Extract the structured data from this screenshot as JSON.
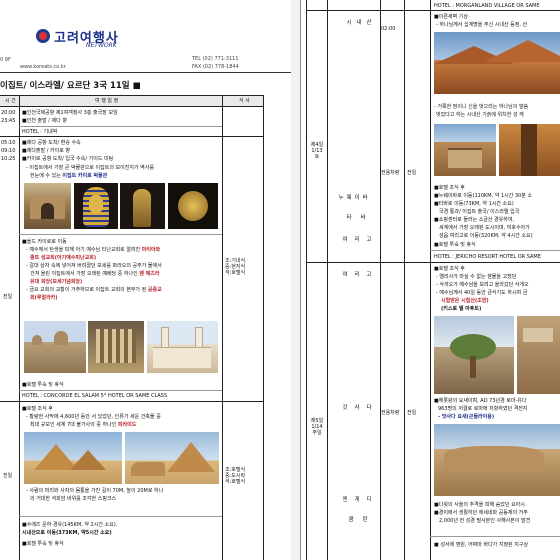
{
  "left": {
    "header": {
      "logo_text": "고려여행사",
      "logo_sub": "NETWORK",
      "addr_prefix": "0 9F",
      "website": "www.koreats.co.kr",
      "tel": "TEL (02) 771-3111",
      "fax": "FAX (02) 778-1844",
      "title": "이집트/ 이스라엘/ 요르단 3국  11일 ■"
    },
    "table_headers": {
      "time": "시 간",
      "itinerary": "여   행   일   정",
      "meal": "식 사"
    },
    "rows1": [
      {
        "time": "20:00",
        "text": "■인천국제공항 제1여객청사 3층 출국장 모임"
      },
      {
        "time": "23:45",
        "text": "■인천 출발 / 제다 향"
      },
      {
        "time": "",
        "text": "HOTEL : 기내박"
      },
      {
        "time": "05:10",
        "text": "■제다 공항 도착/ 환승 수속"
      },
      {
        "time": "09:10",
        "text": "■제다출발 / 카이로 향"
      },
      {
        "time": "10:25",
        "text": "■카이로 공항 도착/ 입국 수속/ 가이드 미팅"
      }
    ],
    "day1_desc1": "- 이집트에서 가장 큰 박물관으로 이집트의 보이진지가 역사를",
    "day1_desc2a": "한눈에 수 있는 ",
    "day1_desc2b": "이집트 카이로 박물관",
    "coptic": [
      "■올드 카이로로 이동",
      "- 예수께서 탄생을 피해 아기 예수님 티난교회로 알려진 ",
      "종뜨 성교회(아기예수피난교회)",
      "- 갈대 상자 속에 넣어져 버려졌던 모세를 파라오의 공주가 물에서",
      "건져 올린 이집트에서 가장 오래된 예배당 중 하나인 ",
      "유대 회당(모세기념회당)",
      "- 금요 교회의 교황이 거주하므로 이집트 교회의 본부가 된 ",
      "회(루알라카)"
    ],
    "coptic_hl": [
      "마리아와",
      "벤 에즈라",
      "공중교"
    ],
    "day1_meal": "조:기내식\n중:현지식\n석:호텔식",
    "day1_label": "전일",
    "day1_hotel_note": "■호텔 투숙 및 휴식",
    "day1_hotel": "HOTEL : CONCORDE EL SALAM 5* HOTEL OR SAME CLASS",
    "day2_lines": [
      "■호텔 조식 후",
      "- 황량한 사막에 4,600년 동안 서 있었던, 인류가 세운 건축물 중",
      "최대 규모인 세계 7대 불가사의 중 하나인 ",
      "- 사람의 머리와 사자의 몸통을 가진 길이 70M, 높이 20M로 하나",
      "의 거대한 석회암 바위를 조각한 스핑크스"
    ],
    "day2_hl": "피라미드",
    "day2_after": [
      "■수에즈 운하 경유(145KM, 약 2시간 소요),",
      "시내산으로 이동(373KM, 약5시간 소요)",
      "■호텔 투숙 및 휴식"
    ],
    "day2_meal": "조:호텔식\n중:도시락\n석:호텔식",
    "day2_label": "전일"
  },
  "right": {
    "hotel_top": "HOTEL : MORGANLAND VILLAGE OR SAME",
    "day4": {
      "label": "제4일\n1/13\n토",
      "places": [
        "시",
        "내",
        "산",
        "누",
        "웨",
        "이",
        "바",
        "타",
        "바",
        "여",
        "리",
        "고"
      ],
      "time": "02:00",
      "transport": "전용차량",
      "allday": "전일",
      "lines_a": [
        "■이른새벽 기상",
        "- 하나님께서 십계명을 주신 시내산 등정,  산"
      ],
      "lines_b": [
        "- 거룩한 땅이니 신을 벗으라는 하나님의 말씀",
        "벗었다고 하는 시내산 기슭에 위치한 성 캐"
      ],
      "lines_c": [
        "■호텔 조식 후",
        "■누웨이바로 이동(110KM, 약 1시간 30분 소",
        "■타바로 이동(73KM, 약 1시간 소요)",
        "국경 통과/ 이집트 출국/ 이스라엘 입국",
        "■쇼핑센터로 들러는 소금산 경유하여,",
        "세계에서 가장 오래된 도시이며, 여호수아가",
        "성읍 여리고로 이동(320KM, 약 4시간 소요)",
        "■호텔 투숙 및 휴식"
      ],
      "hotel": "HOTEL : JERICHO RESORT HOTEL OR SAME"
    },
    "day5": {
      "label": "제5일\n1/14\n주일",
      "places": [
        "여",
        "리",
        "고",
        "갓",
        "사",
        "다",
        "엔",
        "게",
        "디",
        "쿰",
        "란"
      ],
      "transport": "전용차량",
      "allday": "전일",
      "lines_a": [
        "■호텔 조식 후",
        "- 엘리사가 마실 수 없는 샘물을 고쳤던",
        "- 삭개오가 예수님을 보려고 올라갔던 삭개오",
        "- 예수님께서 40일 동안 금식기도 하시며 금",
        "시험받은 시험산(조망)",
        "(키스로 엘 아후트)"
      ],
      "lines_b": [
        "■헤롯왕의 요새이며, AD 73년경 로마-유다",
        "963명의 저결로 로마에 저항하였던 격전지",
        "- 맛사다 요새(곤돌라이용)"
      ],
      "lines_c": [
        "■다윗의 사울의 추격을 피해 숨었던 요아시",
        "■경이에서 생활하던 에세네파 공동체의 거주",
        "2,000년 전 성경 필사본인 사해사본이 발견"
      ],
      "lines_d": [
        "■ 성서에 영원, 어짜마 바다가 지정된 지구상"
      ]
    }
  }
}
